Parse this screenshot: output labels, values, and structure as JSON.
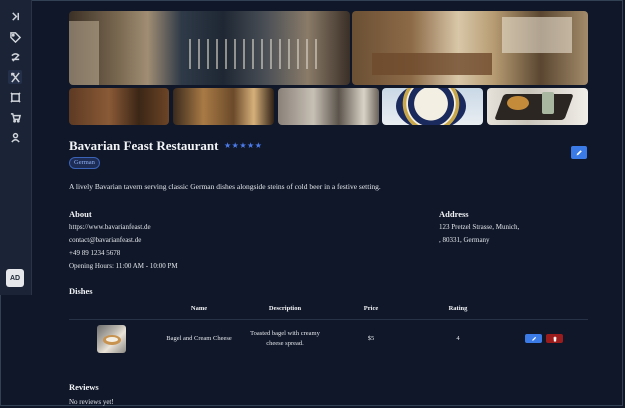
{
  "sidebar": {
    "items": [
      {
        "icon": "collapse-icon"
      },
      {
        "icon": "tag-icon"
      },
      {
        "icon": "chef-hat-icon"
      },
      {
        "icon": "utensils-icon",
        "active": true
      },
      {
        "icon": "menu-board-icon"
      },
      {
        "icon": "cart-icon"
      },
      {
        "icon": "user-icon"
      }
    ],
    "avatar": "AD"
  },
  "restaurant": {
    "name": "Bavarian Feast Restaurant",
    "stars": "★★★★★",
    "cuisine": "German",
    "description": "A lively Bavarian tavern serving classic German dishes alongside steins of cold beer in a festive setting."
  },
  "about": {
    "heading": "About",
    "website": "https://www.bavarianfeast.de",
    "email": "contact@bavarianfeast.de",
    "phone": "+49 89 1234 5678",
    "hours": "Opening Hours: 11:00 AM - 10:00 PM"
  },
  "address": {
    "heading": "Address",
    "street": "123 Pretzel Strasse, Munich,",
    "postal": ", 80331, Germany"
  },
  "dishes": {
    "heading": "Dishes",
    "columns": [
      "Name",
      "Description",
      "Price",
      "Rating"
    ],
    "rows": [
      {
        "name": "Bagel and Cream Cheese",
        "description_line1": "Toasted bagel with creamy",
        "description_line2": "cheese spread.",
        "price": "$5",
        "rating": "4"
      }
    ]
  },
  "reviews": {
    "heading": "Reviews",
    "empty_text": "No reviews yet!"
  },
  "colors": {
    "background": "#0f1729",
    "accent": "#3b7be8",
    "danger": "#9b1c1c"
  }
}
